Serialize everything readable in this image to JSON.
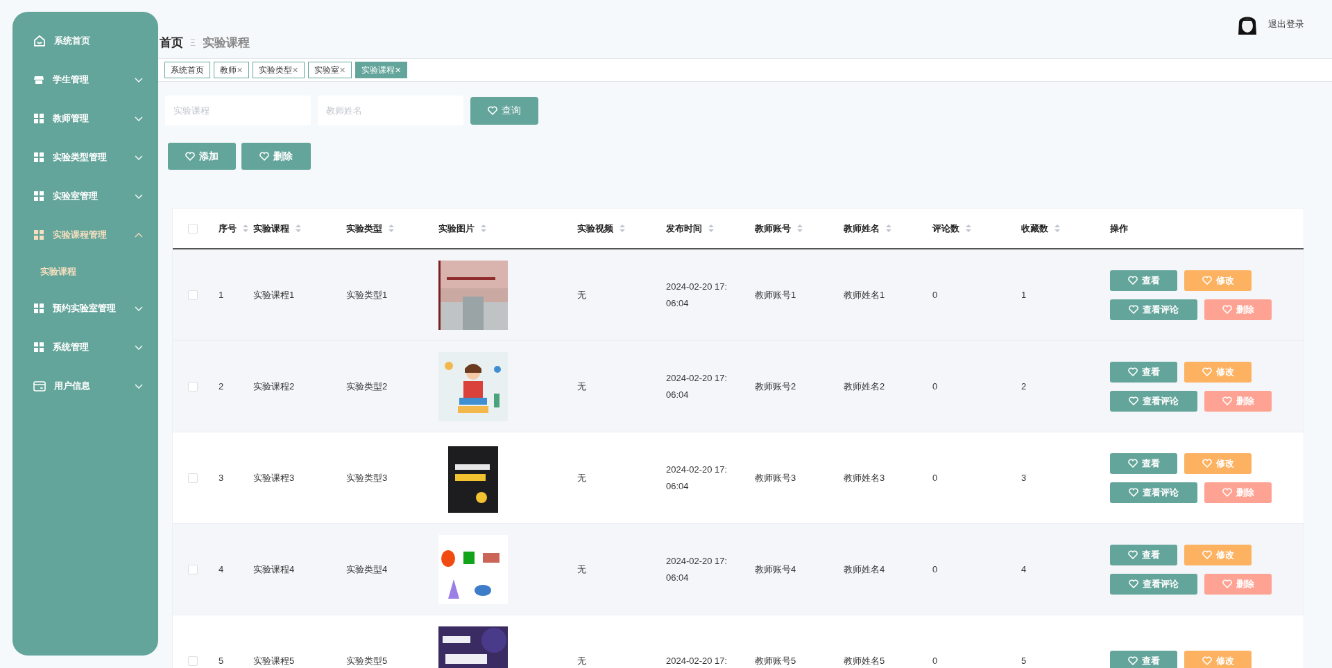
{
  "sidebar": {
    "items": [
      {
        "label": "系统首页",
        "selected": false
      },
      {
        "label": "学生管理",
        "selected": false,
        "expanded": false
      },
      {
        "label": "教师管理",
        "selected": false,
        "expanded": false
      },
      {
        "label": "实验类型管理",
        "selected": false,
        "expanded": false
      },
      {
        "label": "实验室管理",
        "selected": false,
        "expanded": false
      },
      {
        "label": "实验课程管理",
        "selected": true,
        "expanded": true,
        "children": [
          {
            "label": "实验课程",
            "selected": true
          }
        ]
      },
      {
        "label": "预约实验室管理",
        "selected": false,
        "expanded": false
      },
      {
        "label": "系统管理",
        "selected": false,
        "expanded": false
      },
      {
        "label": "用户信息",
        "selected": false,
        "expanded": false
      }
    ]
  },
  "header": {
    "logout": "退出登录"
  },
  "breadcrumb": {
    "home": "首页",
    "separator": "Ξ",
    "current": "实验课程"
  },
  "tabs": [
    {
      "label": "系统首页",
      "closable": false,
      "selected": false
    },
    {
      "label": "教师",
      "closable": true,
      "selected": false
    },
    {
      "label": "实验类型",
      "closable": true,
      "selected": false
    },
    {
      "label": "实验室",
      "closable": true,
      "selected": false
    },
    {
      "label": "实验课程",
      "closable": true,
      "selected": true
    }
  ],
  "close_glyph": "✕",
  "search": {
    "fields": [
      {
        "placeholder": "实验课程"
      },
      {
        "placeholder": "教师姓名"
      }
    ],
    "button": "查询"
  },
  "toolbar": [
    "添加",
    "删除"
  ],
  "table": {
    "columns": [
      "序号",
      "实验课程",
      "实验类型",
      "实验图片",
      "实验视频",
      "发布时间",
      "教师账号",
      "教师姓名",
      "评论数",
      "收藏数",
      "操作"
    ],
    "sortable": [
      true,
      true,
      true,
      true,
      true,
      true,
      true,
      true,
      true,
      true,
      false
    ],
    "all_checked": false,
    "rows": [
      {
        "checked": false,
        "cells": [
          "1",
          "实验课程1",
          "实验类型1",
          {
            "kind": "picture"
          },
          "无",
          [
            "2024-02-20 17:",
            "06:04"
          ],
          "教师账号1",
          "教师姓名1",
          "0",
          "1"
        ],
        "actions": [
          {
            "label": "查看",
            "kind": "view"
          },
          {
            "label": "修改",
            "kind": "edit"
          },
          {
            "label": "查看评论",
            "kind": "view"
          },
          {
            "label": "删除",
            "kind": "delete"
          }
        ]
      },
      {
        "checked": false,
        "cells": [
          "2",
          "实验课程2",
          "实验类型2",
          {
            "kind": "picture"
          },
          "无",
          [
            "2024-02-20 17:",
            "06:04"
          ],
          "教师账号2",
          "教师姓名2",
          "0",
          "2"
        ],
        "actions": [
          {
            "label": "查看",
            "kind": "view"
          },
          {
            "label": "修改",
            "kind": "edit"
          },
          {
            "label": "查看评论",
            "kind": "view"
          },
          {
            "label": "删除",
            "kind": "delete"
          }
        ]
      },
      {
        "checked": false,
        "cells": [
          "3",
          "实验课程3",
          "实验类型3",
          {
            "kind": "picture"
          },
          "无",
          [
            "2024-02-20 17:",
            "06:04"
          ],
          "教师账号3",
          "教师姓名3",
          "0",
          "3"
        ],
        "actions": [
          {
            "label": "查看",
            "kind": "view"
          },
          {
            "label": "修改",
            "kind": "edit"
          },
          {
            "label": "查看评论",
            "kind": "view"
          },
          {
            "label": "删除",
            "kind": "delete"
          }
        ]
      },
      {
        "checked": false,
        "cells": [
          "4",
          "实验课程4",
          "实验类型4",
          {
            "kind": "picture"
          },
          "无",
          [
            "2024-02-20 17:",
            "06:04"
          ],
          "教师账号4",
          "教师姓名4",
          "0",
          "4"
        ],
        "actions": [
          {
            "label": "查看",
            "kind": "view"
          },
          {
            "label": "修改",
            "kind": "edit"
          },
          {
            "label": "查看评论",
            "kind": "view"
          },
          {
            "label": "删除",
            "kind": "delete"
          }
        ]
      },
      {
        "checked": false,
        "cells": [
          "5",
          "实验课程5",
          "实验类型5",
          {
            "kind": "picture"
          },
          "无",
          [
            "2024-02-20 17:"
          ],
          "教师账号5",
          "教师姓名5",
          "0",
          "5"
        ],
        "actions": [
          {
            "label": "查看",
            "kind": "view"
          },
          {
            "label": "修改",
            "kind": "edit"
          }
        ]
      }
    ]
  }
}
